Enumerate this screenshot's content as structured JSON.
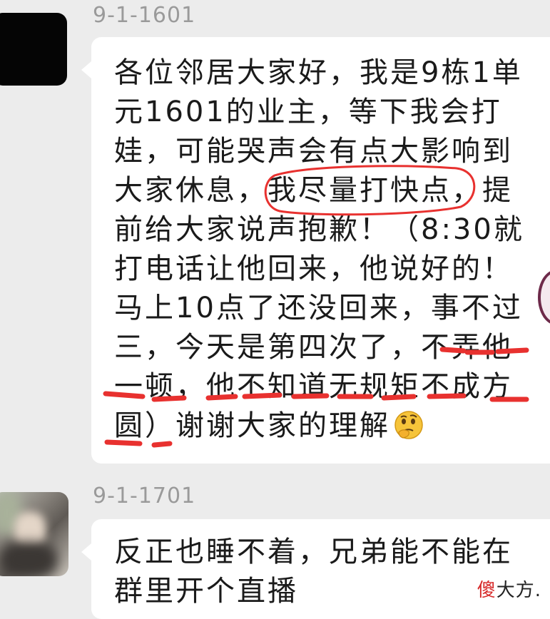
{
  "messages": [
    {
      "sender": "9-1-1601",
      "lines": [
        "各位邻居大家好，我是9栋1单",
        "元1601的业主，等下我会打",
        "娃，可能哭声会有点大影响到",
        "大家休息，我尽量打快点，提",
        "前给大家说声抱歉！（8:30就",
        "打电话让他回来，他说好的！",
        "马上10点了还没回来，事不过",
        "三，今天是第四次了，不弄他",
        "一顿，他不知道无规矩不成方",
        "圆）谢谢大家的理解"
      ],
      "emoji": "thinking-face-emoji"
    },
    {
      "sender": "9-1-1701",
      "lines": [
        "反正也睡不着，兄弟能不能在",
        "群里开个直播"
      ]
    }
  ],
  "watermark": {
    "part1": "傻",
    "part2": "大方."
  },
  "colors": {
    "annotation_red": "#e8312f",
    "background": "#ececec",
    "bubble": "#ffffff",
    "sender_text": "#9a9a9a"
  }
}
